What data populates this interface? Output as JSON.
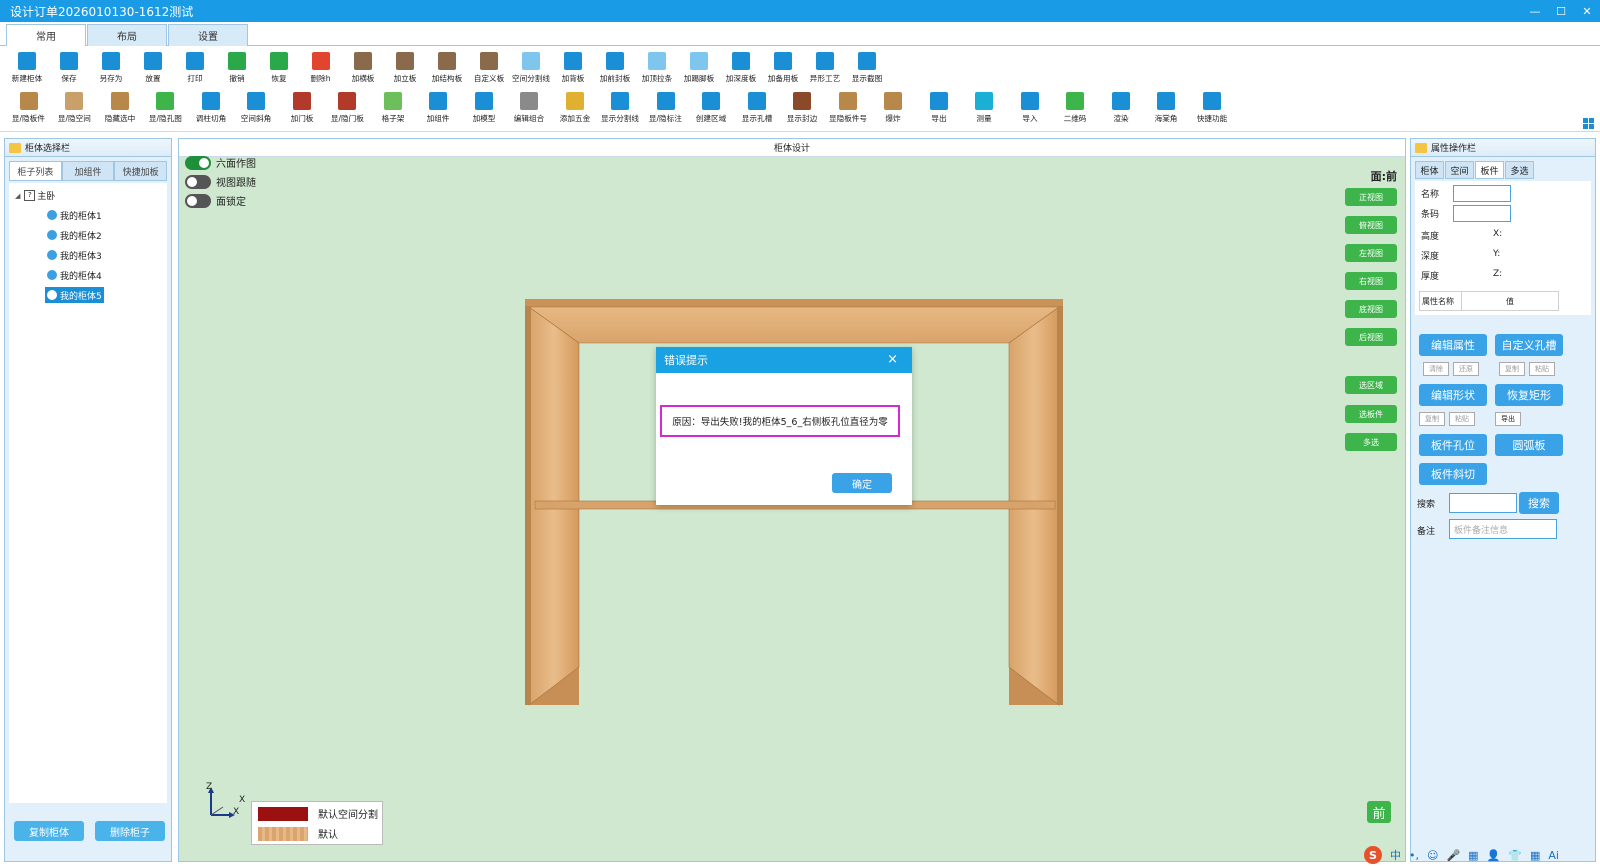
{
  "window": {
    "title": "设计订单2026010130-1612测试"
  },
  "ribbon_tabs": [
    "常用",
    "布局",
    "设置"
  ],
  "toolbar_row1": [
    {
      "label": "新建柜体",
      "icon": "new-cabinet-icon",
      "color": "#1a8fd6"
    },
    {
      "label": "保存",
      "icon": "save-icon",
      "color": "#1a8fd6"
    },
    {
      "label": "另存为",
      "icon": "save-as-icon",
      "color": "#1a8fd6"
    },
    {
      "label": "放置",
      "icon": "place-icon",
      "color": "#1a8fd6"
    },
    {
      "label": "打印",
      "icon": "print-icon",
      "color": "#1a8fd6"
    },
    {
      "label": "撤销",
      "icon": "undo-icon",
      "color": "#2aa84a"
    },
    {
      "label": "恢复",
      "icon": "redo-icon",
      "color": "#2aa84a"
    },
    {
      "label": "删除h",
      "icon": "delete-icon",
      "color": "#e2452e"
    },
    {
      "label": "加横板",
      "icon": "add-horizontal-board-icon",
      "color": "#8a6a4a"
    },
    {
      "label": "加立板",
      "icon": "add-vertical-board-icon",
      "color": "#8a6a4a"
    },
    {
      "label": "加结构板",
      "icon": "add-structure-board-icon",
      "color": "#8a6a4a"
    },
    {
      "label": "自定义板",
      "icon": "custom-board-icon",
      "color": "#8a6a4a"
    },
    {
      "label": "空间分割线",
      "icon": "space-divider-icon",
      "color": "#7fc6ef"
    },
    {
      "label": "加背板",
      "icon": "add-back-board-icon",
      "color": "#1a8fd6"
    },
    {
      "label": "加前封板",
      "icon": "add-front-seal-icon",
      "color": "#1a8fd6"
    },
    {
      "label": "加顶拉条",
      "icon": "add-top-strip-icon",
      "color": "#7fc6ef"
    },
    {
      "label": "加踢脚板",
      "icon": "add-kickboard-icon",
      "color": "#7fc6ef"
    },
    {
      "label": "加深度板",
      "icon": "add-depth-board-icon",
      "color": "#1a8fd6"
    },
    {
      "label": "加备用板",
      "icon": "add-spare-board-icon",
      "color": "#1a8fd6"
    },
    {
      "label": "异形工艺",
      "icon": "special-process-icon",
      "color": "#1a8fd6"
    },
    {
      "label": "显示截图",
      "icon": "show-screenshot-icon",
      "color": "#1a8fd6"
    }
  ],
  "toolbar_row2": [
    {
      "label": "显/隐板件",
      "icon": "toggle-board-icon",
      "color": "#b8874a"
    },
    {
      "label": "显/隐空间",
      "icon": "toggle-space-icon",
      "color": "#c9a06a"
    },
    {
      "label": "隐藏选中",
      "icon": "hide-selected-icon",
      "color": "#b8874a"
    },
    {
      "label": "显/隐孔图",
      "icon": "toggle-hole-icon",
      "color": "#3db54a"
    },
    {
      "label": "调柱切角",
      "icon": "column-corner-icon",
      "color": "#1a8fd6"
    },
    {
      "label": "空间斜角",
      "icon": "space-bevel-icon",
      "color": "#1a8fd6"
    },
    {
      "label": "加门板",
      "icon": "add-door-icon",
      "color": "#b23a2a"
    },
    {
      "label": "显/隐门板",
      "icon": "toggle-door-icon",
      "color": "#b23a2a"
    },
    {
      "label": "格子架",
      "icon": "grid-rack-icon",
      "color": "#6cbf5a"
    },
    {
      "label": "加组件",
      "icon": "add-component-icon",
      "color": "#1a8fd6"
    },
    {
      "label": "加模型",
      "icon": "add-model-icon",
      "color": "#1a8fd6"
    },
    {
      "label": "编辑组合",
      "icon": "edit-group-icon",
      "color": "#8a8a8a"
    },
    {
      "label": "添加五金",
      "icon": "add-hardware-icon",
      "color": "#e0b030"
    },
    {
      "label": "显示分割线",
      "icon": "show-divider-icon",
      "color": "#1a8fd6"
    },
    {
      "label": "显/隐标注",
      "icon": "toggle-annotation-icon",
      "color": "#1a8fd6"
    },
    {
      "label": "创建区域",
      "icon": "create-region-icon",
      "color": "#1a8fd6"
    },
    {
      "label": "显示孔槽",
      "icon": "show-hole-slot-icon",
      "color": "#1a8fd6"
    },
    {
      "label": "显示封边",
      "icon": "show-edge-banding-icon",
      "color": "#8a4a2a"
    },
    {
      "label": "显隐板件号",
      "icon": "toggle-board-number-icon",
      "color": "#b8874a"
    },
    {
      "label": "爆炸",
      "icon": "explode-icon",
      "color": "#b8874a"
    },
    {
      "label": "导出",
      "icon": "export-icon",
      "color": "#1a8fd6"
    },
    {
      "label": "测量",
      "icon": "measure-icon",
      "color": "#1ab0d6"
    },
    {
      "label": "导入",
      "icon": "import-icon",
      "color": "#1a8fd6"
    },
    {
      "label": "二维码",
      "icon": "qrcode-icon",
      "color": "#3db54a"
    },
    {
      "label": "渲染",
      "icon": "render-icon",
      "color": "#1a8fd6"
    },
    {
      "label": "海棠角",
      "icon": "begonia-corner-icon",
      "color": "#1a8fd6"
    },
    {
      "label": "快捷功能",
      "icon": "quick-function-icon",
      "color": "#1a8fd6"
    }
  ],
  "left_panel": {
    "title": "柜体选择栏",
    "tabs": [
      "柜子列表",
      "加组件",
      "快捷加板"
    ],
    "root": "主卧",
    "items": [
      "我的柜体1",
      "我的柜体2",
      "我的柜体3",
      "我的柜体4",
      "我的柜体5"
    ],
    "selected_index": 4,
    "copy_button": "复制柜体",
    "delete_button": "删除柜子"
  },
  "design": {
    "title": "柜体设计",
    "toggles": [
      {
        "label": "六面作图",
        "on": true
      },
      {
        "label": "视图跟随",
        "on": false
      },
      {
        "label": "面锁定",
        "on": false
      }
    ],
    "face_label": "面:前",
    "view_buttons": [
      "正视图",
      "俯视图",
      "左视图",
      "右视图",
      "底视图",
      "后视图"
    ],
    "select_buttons": [
      "选区域",
      "选板件",
      "多选"
    ],
    "axes": {
      "z": "Z",
      "x": "X",
      "x2": "X"
    },
    "legend": [
      {
        "label": "默认空间分割",
        "color": "#9b1010"
      },
      {
        "label": "默认",
        "color": "#d9a46e"
      }
    ],
    "front_badge": "前"
  },
  "dialog": {
    "title": "错误提示",
    "close": "×",
    "message": "原因：导出失败!我的柜体5_6_右侧板孔位直径为零",
    "ok": "确定"
  },
  "right_panel": {
    "title": "属性操作栏",
    "tabs": [
      "柜体",
      "空间",
      "板件",
      "多选"
    ],
    "active_tab": 2,
    "name_label": "名称",
    "code_label": "条码",
    "height_label": "高度",
    "depth_label": "深度",
    "thickness_label": "厚度",
    "x_label": "X:",
    "y_label": "Y:",
    "z_label": "Z:",
    "attr_name_header": "属性名称",
    "attr_value_header": "值",
    "edit_attr": "编辑属性",
    "custom_hole": "自定义孔槽",
    "small_row1": [
      "清除",
      "还原",
      "复制",
      "粘贴"
    ],
    "edit_shape": "编辑形状",
    "restore_rect": "恢复矩形",
    "small_row2": [
      "复制",
      "粘贴",
      "导出"
    ],
    "board_hole": "板件孔位",
    "arc_board": "圆弧板",
    "board_bevel": "板件斜切",
    "search_label": "搜索",
    "search_button": "搜索",
    "remark_label": "备注",
    "remark_placeholder": "板件备注信息"
  },
  "tray": [
    "S",
    "中",
    "•,",
    "☺",
    "🎤",
    "▦",
    "👤",
    "👕",
    "▦",
    "Ai"
  ]
}
